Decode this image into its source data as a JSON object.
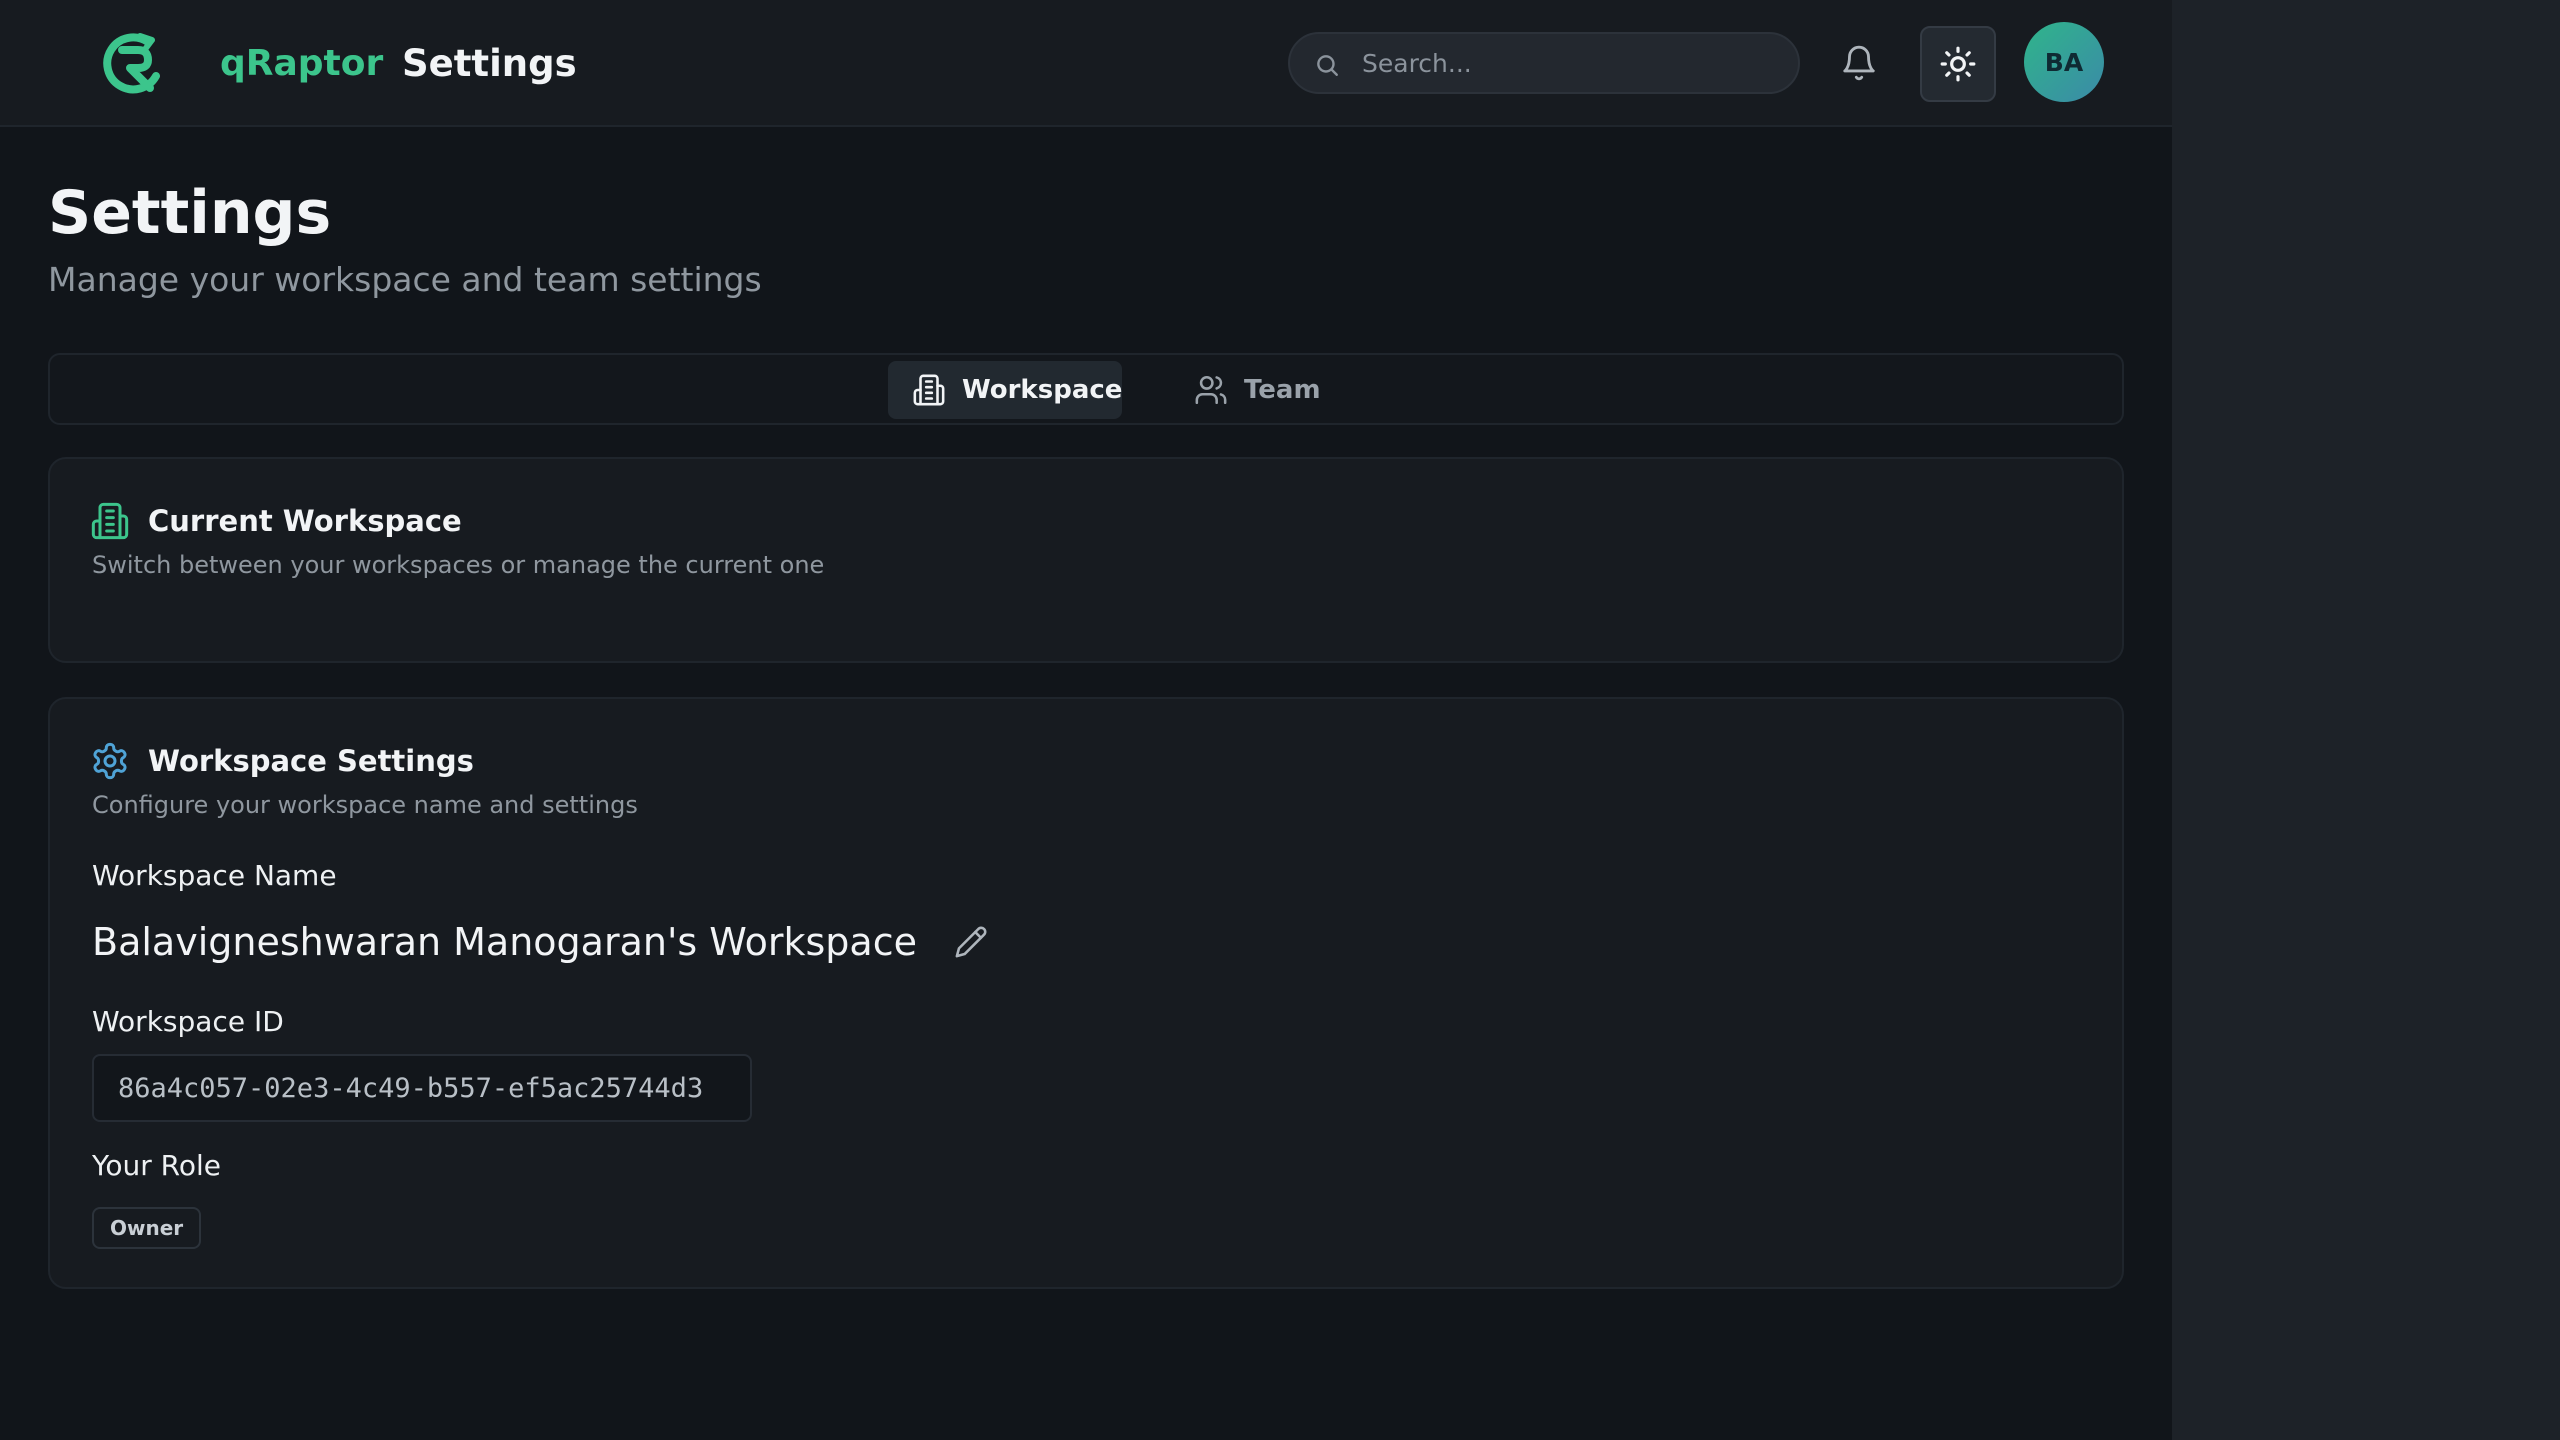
{
  "app": {
    "brand": "qRaptor",
    "section_title": "Settings"
  },
  "header": {
    "search_placeholder": "Search...",
    "avatar_initials": "BA"
  },
  "page": {
    "title": "Settings",
    "subtitle": "Manage your workspace and team settings"
  },
  "tabs": [
    {
      "label": "Workspace",
      "icon": "building-icon",
      "active": true
    },
    {
      "label": "Team",
      "icon": "users-icon",
      "active": false
    }
  ],
  "current_workspace": {
    "title": "Current Workspace",
    "description": "Switch between your workspaces or manage the current one"
  },
  "workspace_settings": {
    "title": "Workspace Settings",
    "description": "Configure your workspace name and settings",
    "name_label": "Workspace Name",
    "name_value": "Balavigneshwaran Manogaran's Workspace",
    "id_label": "Workspace ID",
    "id_value": "86a4c057-02e3-4c49-b557-ef5ac25744d3",
    "role_label": "Your Role",
    "role_value": "Owner"
  },
  "colors": {
    "accent": "#3cc58c",
    "settings_icon": "#4fa3d6",
    "background": "#11151a",
    "card": "#171b20"
  }
}
